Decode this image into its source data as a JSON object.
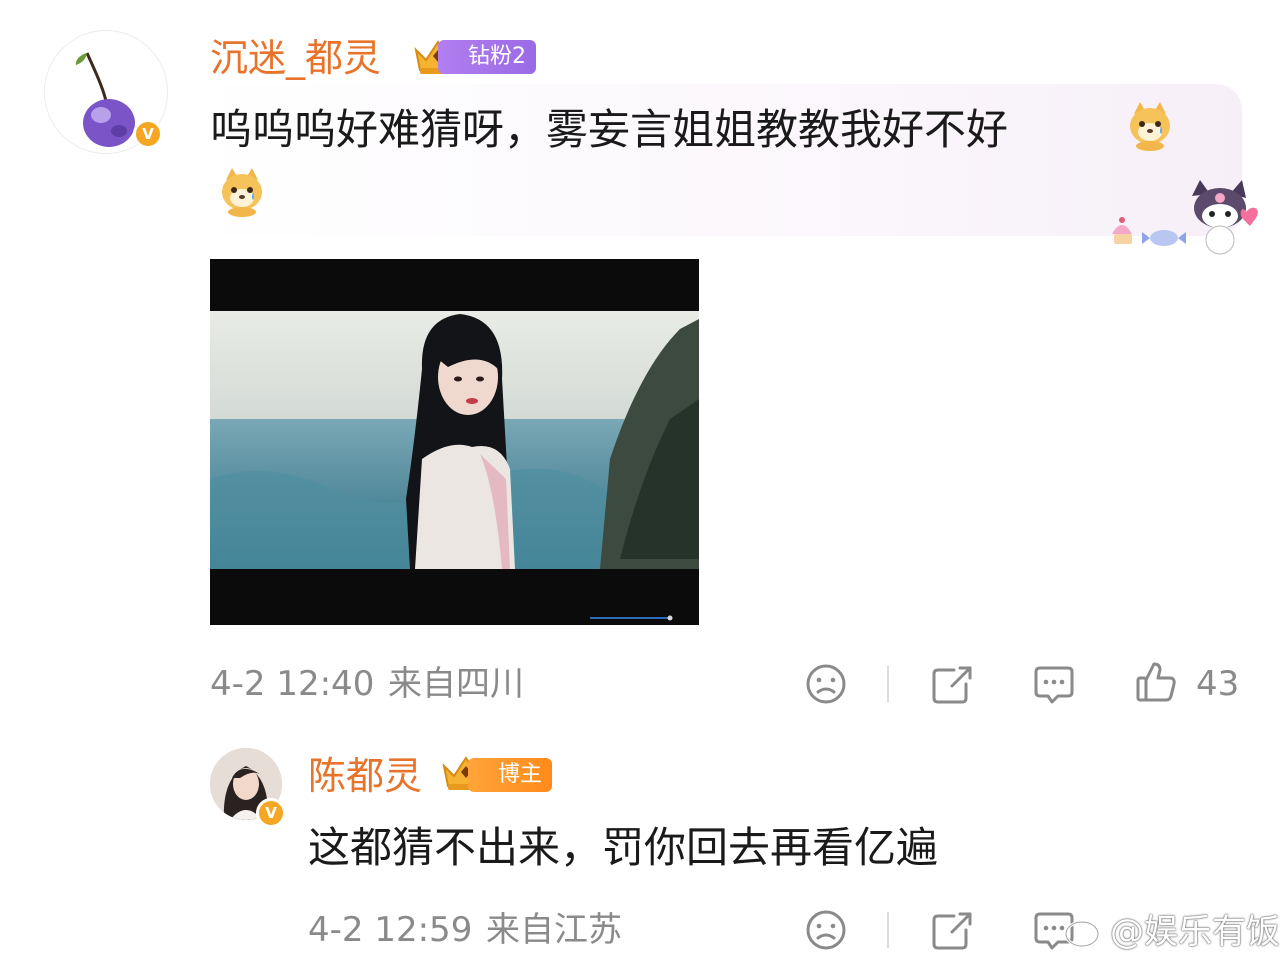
{
  "comment": {
    "username": "沉迷_都灵",
    "fan_badge": "钻粉2",
    "text_line1": "呜呜呜好难猜呀，雾妄言姐姐教教我好不好",
    "timestamp": "4-2 12:40",
    "location": "来自四川",
    "like_count": "43",
    "icons": [
      "sad-face-icon",
      "share-icon",
      "comment-icon",
      "thumbs-up-icon"
    ]
  },
  "reply": {
    "username": "陈都灵",
    "badge": "博主",
    "text": "这都猜不出来，罚你回去再看亿遍",
    "timestamp": "4-2 12:59",
    "location": "来自江苏"
  },
  "watermark": {
    "text": "@娱乐有饭"
  },
  "colors": {
    "username": "#e8732a",
    "verified": "#f5a623",
    "fan_badge": "#a574ec",
    "host_badge": "#ff921f",
    "meta_text": "#8a8a8a"
  }
}
